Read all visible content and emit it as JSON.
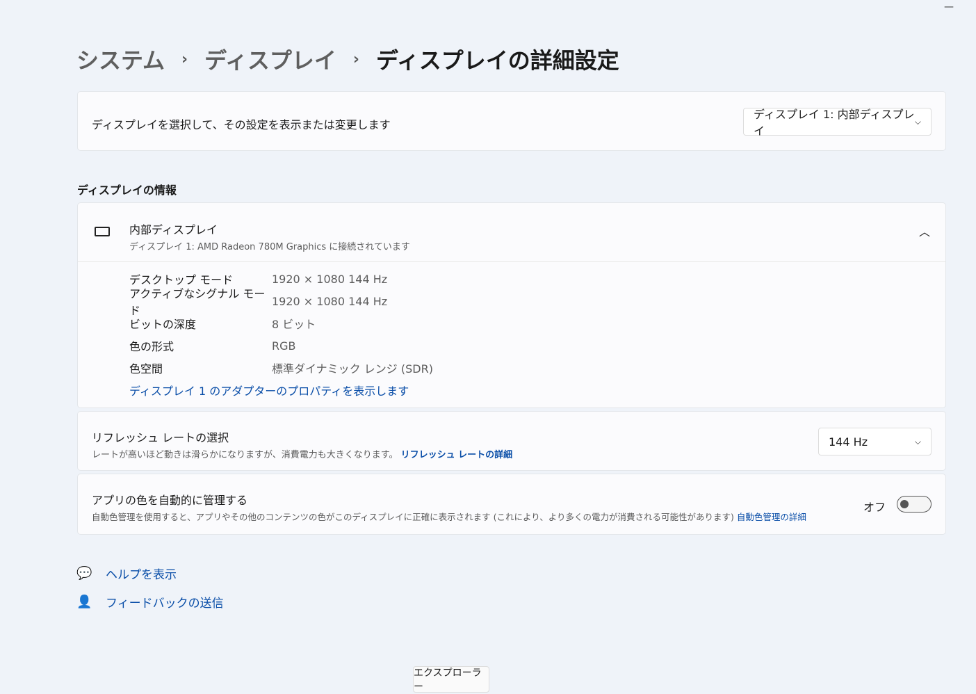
{
  "window": {
    "minimize": "—"
  },
  "breadcrumb": [
    "システム",
    "ディスプレイ",
    "ディスプレイの詳細設定"
  ],
  "select_display": {
    "label": "ディスプレイを選択して、その設定を表示または変更します",
    "value": "ディスプレイ 1: 内部ディスプレイ"
  },
  "info_section": "ディスプレイの情報",
  "display": {
    "title": "内部ディスプレイ",
    "subtitle": "ディスプレイ 1: AMD Radeon 780M Graphics に接続されています",
    "rows": [
      {
        "k": "デスクトップ モード",
        "v": "1920 × 1080 144 Hz"
      },
      {
        "k": "アクティブなシグナル モード",
        "v": "1920 × 1080 144 Hz"
      },
      {
        "k": "ビットの深度",
        "v": "8 ビット"
      },
      {
        "k": "色の形式",
        "v": "RGB"
      },
      {
        "k": "色空間",
        "v": "標準ダイナミック レンジ (SDR)"
      }
    ],
    "adapter_link": "ディスプレイ 1 のアダプターのプロパティを表示します"
  },
  "refresh": {
    "title": "リフレッシュ レートの選択",
    "desc": "レートが高いほど動きは滑らかになりますが、消費電力も大きくなります。",
    "link": "リフレッシュ レートの詳細",
    "value": "144 Hz"
  },
  "color": {
    "title": "アプリの色を自動的に管理する",
    "desc": "自動色管理を使用すると、アプリやその他のコンテンツの色がこのディスプレイに正確に表示されます (これにより、より多くの電力が消費される可能性があります)",
    "link": "自動色管理の詳細",
    "state": "オフ"
  },
  "footer": {
    "help": "ヘルプを表示",
    "feedback": "フィードバックの送信"
  },
  "tooltip": "エクスプローラー"
}
